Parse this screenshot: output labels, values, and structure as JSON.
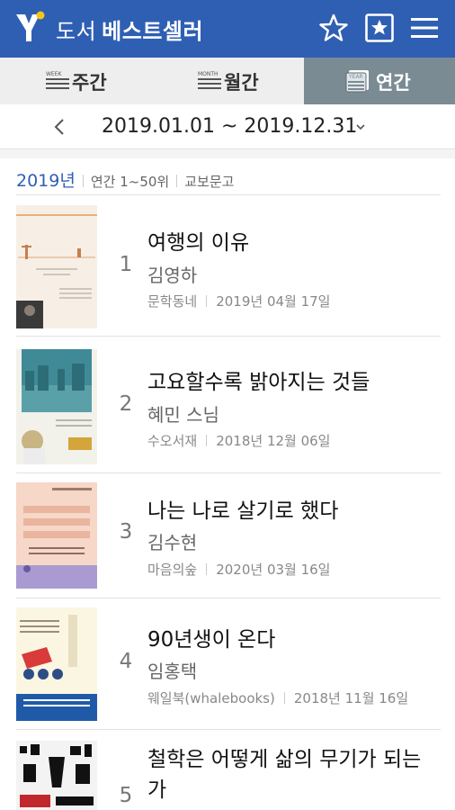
{
  "header": {
    "title_prefix": "도서",
    "title_main": "베스트셀러",
    "brand_color": "#2f5fb3",
    "icons": [
      "star-icon",
      "bookmark-star-icon",
      "menu-icon"
    ]
  },
  "tabs": [
    {
      "label": "주간",
      "tag": "WEEK",
      "active": false
    },
    {
      "label": "월간",
      "tag": "MONTH",
      "active": false
    },
    {
      "label": "연간",
      "tag": "YEAR",
      "active": true
    }
  ],
  "date_bar": {
    "range": "2019.01.01 ~ 2019.12.31"
  },
  "list_meta": {
    "year": "2019년",
    "scope": "연간 1~50위",
    "source": "교보문고"
  },
  "books": [
    {
      "rank": "1",
      "title": "여행의 이유",
      "author": "김영하",
      "publisher": "문학동네",
      "date": "2019년 04월 17일"
    },
    {
      "rank": "2",
      "title": "고요할수록 밝아지는 것들",
      "author": "혜민 스님",
      "publisher": "수오서재",
      "date": "2018년 12월 06일"
    },
    {
      "rank": "3",
      "title": "나는 나로 살기로 했다",
      "author": "김수현",
      "publisher": "마음의숲",
      "date": "2020년 03월 16일"
    },
    {
      "rank": "4",
      "title": "90년생이 온다",
      "author": "임홍택",
      "publisher": "웨일북(whalebooks)",
      "date": "2018년 11월 16일"
    },
    {
      "rank": "5",
      "title_line1": "철학은 어떻게 삶의 무기가 되는",
      "title_line2": "가"
    }
  ]
}
